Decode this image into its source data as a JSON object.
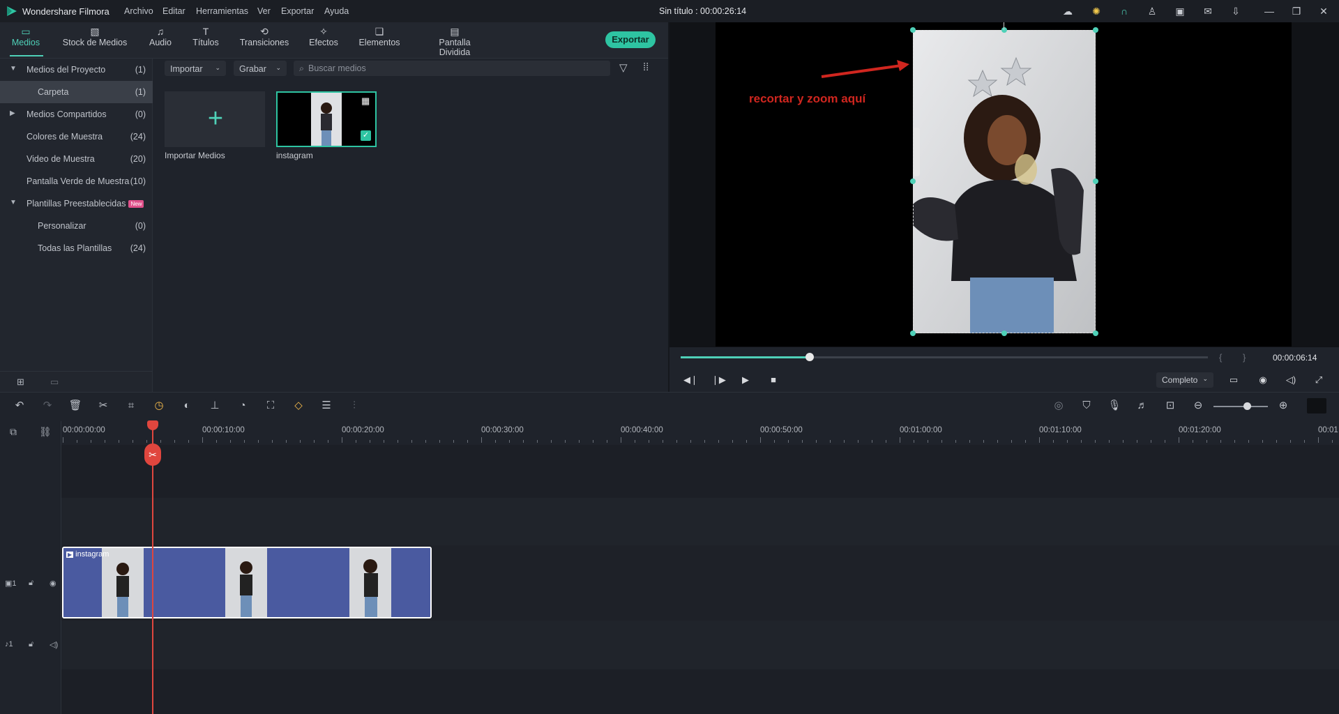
{
  "app": {
    "name": "Wondershare Filmora",
    "document_title": "Sin título : 00:00:26:14",
    "menu": [
      "Archivo",
      "Editar",
      "Herramientas",
      "Ver",
      "Exportar",
      "Ayuda"
    ]
  },
  "tabs": [
    {
      "label": "Medios",
      "icon": "folder-icon"
    },
    {
      "label": "Stock de Medios",
      "icon": "stock-media-icon"
    },
    {
      "label": "Audio",
      "icon": "music-note-icon"
    },
    {
      "label": "Títulos",
      "icon": "text-t-icon"
    },
    {
      "label": "Transiciones",
      "icon": "transition-icon"
    },
    {
      "label": "Efectos",
      "icon": "effects-sparkle-icon"
    },
    {
      "label": "Elementos",
      "icon": "elements-icon"
    },
    {
      "label": "Pantalla Dividida",
      "icon": "split-screen-icon"
    }
  ],
  "export_label": "Exportar",
  "sidebar": {
    "items": [
      {
        "label": "Medios del Proyecto",
        "count": "(1)"
      },
      {
        "label": "Carpeta",
        "count": "(1)"
      },
      {
        "label": "Medios Compartidos",
        "count": "(0)"
      },
      {
        "label": "Colores de Muestra",
        "count": "(24)"
      },
      {
        "label": "Video de Muestra",
        "count": "(20)"
      },
      {
        "label": "Pantalla Verde de Muestra",
        "count": "(10)"
      },
      {
        "label": "Plantillas Preestablecidas",
        "count": ""
      },
      {
        "label": "Personalizar",
        "count": "(0)"
      },
      {
        "label": "Todas las Plantillas",
        "count": "(24)"
      }
    ],
    "new_badge": "New"
  },
  "media": {
    "import_dropdown": "Importar",
    "record_dropdown": "Grabar",
    "search_placeholder": "Buscar medios",
    "import_tile_label": "Importar Medios",
    "clip_tile_label": "instagram"
  },
  "preview": {
    "annotation": "recortar y zoom aquí",
    "timecode": "00:00:06:14",
    "progress_fraction": 0.245,
    "quality": "Completo"
  },
  "timeline": {
    "ruler_labels": [
      "00:00:00:00",
      "00:00:10:00",
      "00:00:20:00",
      "00:00:30:00",
      "00:00:40:00",
      "00:00:50:00",
      "00:01:00:00",
      "00:01:10:00",
      "00:01:20:00",
      "00:01"
    ],
    "video_track_label": "1",
    "audio_track_label": "1",
    "clip_name": "instagram"
  },
  "colors": {
    "accent": "#2ec4a2",
    "playhead": "#e0463e",
    "clip": "#4a5aa0"
  }
}
